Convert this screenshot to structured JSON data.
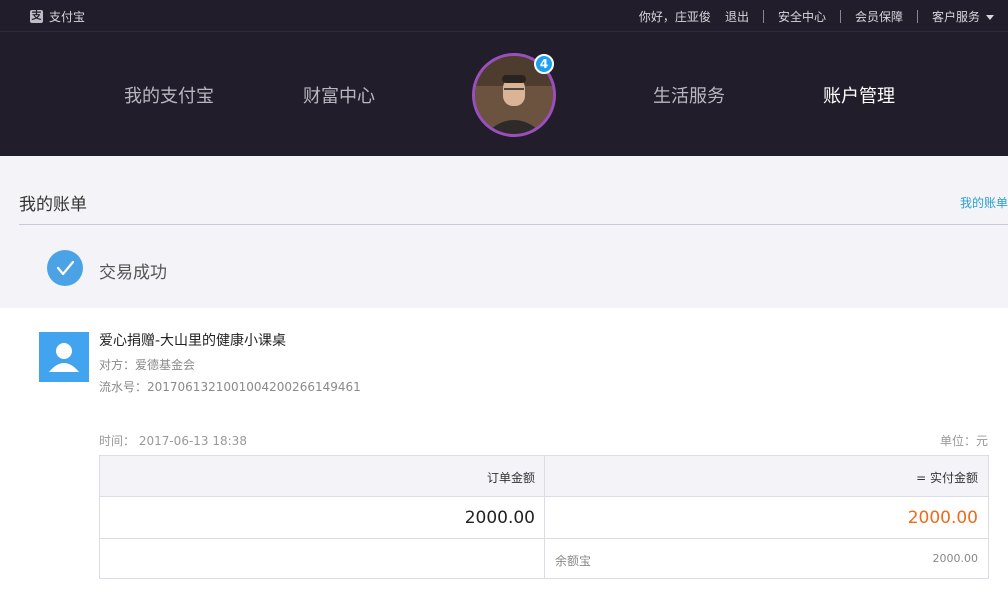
{
  "topbar": {
    "logo_text": "支付宝",
    "greeting": "你好，庄亚俊",
    "logout": "退出",
    "security_center": "安全中心",
    "member_protection": "会员保障",
    "customer_service": "客户服务"
  },
  "mainnav": {
    "items": [
      "我的支付宝",
      "财富中心",
      "生活服务",
      "账户管理"
    ],
    "active": "账户管理",
    "badge_count": "4"
  },
  "bill": {
    "title": "我的账单",
    "link": "我的账单",
    "status": "交易成功"
  },
  "payee": {
    "title": "爱心捐赠-大山里的健康小课桌",
    "party": "对方：爱德基金会",
    "serial": "流水号：20170613210010042002661494‌61"
  },
  "meta": {
    "time": "时间：  2017-06-13 18:38",
    "unit": "单位：元"
  },
  "table": {
    "col1_header": "订单金额",
    "col2_header": "= 实付金额",
    "order_amount": "2000.00",
    "paid_amount": "2000.00",
    "method": "余额宝",
    "method_amount": "2000.00"
  },
  "colors": {
    "nav_bg": "#221d2a",
    "accent_blue": "#4ba3e6",
    "amount_orange": "#f06a1a",
    "link_blue": "#2a9fd6",
    "avatar_ring": "#9b4fbf"
  }
}
